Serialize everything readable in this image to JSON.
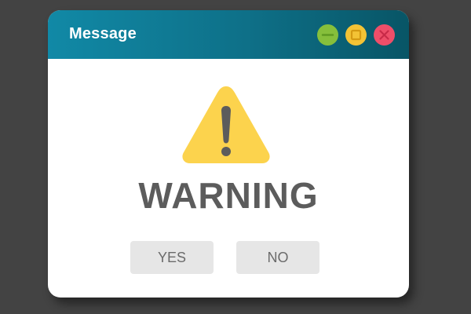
{
  "window": {
    "title": "Message"
  },
  "controls": {
    "minimize_icon": "minimize-icon",
    "maximize_icon": "maximize-icon",
    "close_icon": "close-icon"
  },
  "content": {
    "icon": "warning-triangle-icon",
    "heading": "WARNING"
  },
  "buttons": {
    "yes_label": "YES",
    "no_label": "NO"
  },
  "colors": {
    "background": "#434343",
    "titlebar": "#0e7a93",
    "minimize": "#86bf3b",
    "maximize": "#f3c335",
    "close": "#ee4e69",
    "warning_icon": "#fcd34d",
    "heading_text": "#5c5c5c",
    "button_bg": "#e6e6e6"
  }
}
